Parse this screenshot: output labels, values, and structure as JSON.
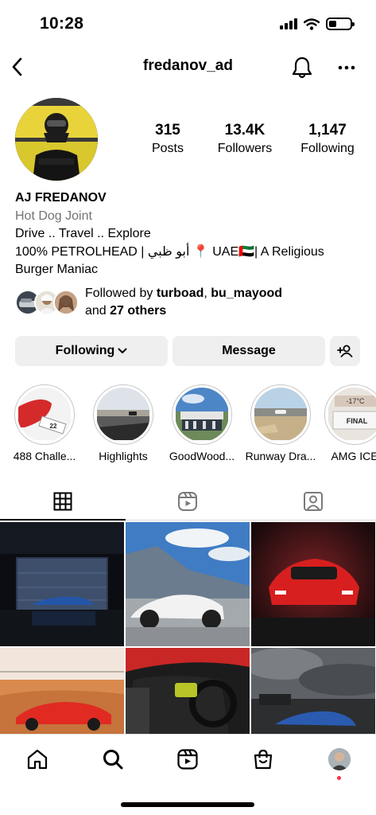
{
  "status_bar": {
    "time": "10:28",
    "battery_level": 0.35
  },
  "header": {
    "username": "fredanov_ad"
  },
  "profile": {
    "stats": [
      {
        "value": "315",
        "label": "Posts"
      },
      {
        "value": "13.4K",
        "label": "Followers"
      },
      {
        "value": "1,147",
        "label": "Following"
      }
    ],
    "name": "AJ FREDANOV",
    "category": "Hot Dog Joint",
    "bio_line1": "Drive .. Travel .. Explore",
    "bio_line2": "100% PETROLHEAD | أبو ظبي 📍 UAE🇦🇪| A Religious",
    "bio_line3": "Burger Maniac"
  },
  "followed_by": {
    "prefix": "Followed by ",
    "user1": "turboad",
    "sep": ", ",
    "user2": "bu_mayood",
    "and": "and ",
    "others": "27 others"
  },
  "buttons": {
    "following": "Following",
    "message": "Message"
  },
  "highlights": [
    {
      "label": "488 Challe..."
    },
    {
      "label": "Highlights"
    },
    {
      "label": "GoodWood..."
    },
    {
      "label": "Runway Dra..."
    },
    {
      "label": "AMG ICE"
    }
  ],
  "highlight_texts": {
    "plate": "22",
    "temp": "-17°C",
    "final": "FINAL"
  },
  "colors": {
    "accent_red": "#ff3040",
    "button_bg": "#efefef",
    "secondary_text": "#737373"
  },
  "icons": {
    "back": "chevron-left-icon",
    "bell": "bell-icon",
    "more": "more-horizontal-icon",
    "add_user": "add-user-icon",
    "grid": "grid-icon",
    "reels": "reels-icon",
    "tagged": "tagged-icon",
    "home": "home-icon",
    "search": "search-icon",
    "shop": "shop-icon"
  }
}
